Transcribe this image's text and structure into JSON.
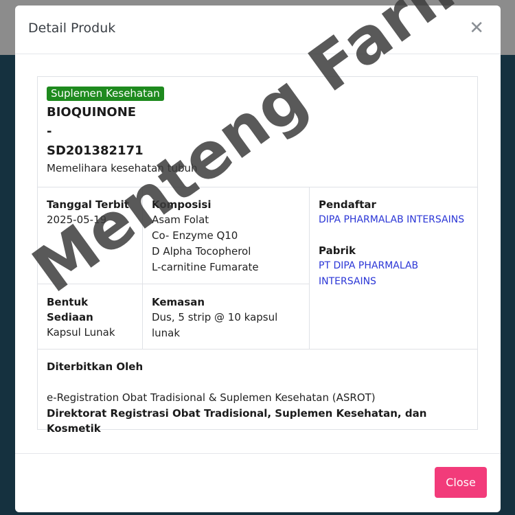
{
  "modal": {
    "title": "Detail Produk",
    "close_icon": "close-icon",
    "close_button": "Close"
  },
  "product": {
    "category_badge": "Suplemen Kesehatan",
    "name_line1": "BIOQUINONE",
    "name_line2": "-",
    "name_line3": "SD201382171",
    "description": "Memelihara kesehatan tubuh"
  },
  "details": {
    "tanggal_label": "Tanggal Terbit",
    "tanggal_value": "2025-05-19",
    "komposisi_label": "Komposisi",
    "komposisi_items": [
      "Asam Folat",
      "Co- Enzyme Q10",
      "D Alpha Tocopherol",
      "L-carnitine Fumarate"
    ],
    "pendaftar_label": "Pendaftar",
    "pendaftar_value": "DIPA PHARMALAB INTERSAINS",
    "pabrik_label": "Pabrik",
    "pabrik_value": "PT DIPA PHARMALAB INTERSAINS",
    "bentuk_label": "Bentuk Sediaan",
    "bentuk_value": "Kapsul Lunak",
    "kemasan_label": "Kemasan",
    "kemasan_value": "Dus, 5 strip @ 10 kapsul lunak",
    "diterbitkan_label": "Diterbitkan Oleh",
    "diterbitkan_value1": "e-Registration Obat Tradisional & Suplemen Kesehatan (ASROT)",
    "diterbitkan_value2": "Direktorat Registrasi Obat Tradisional, Suplemen Kesehatan, dan Kosmetik"
  },
  "watermark": "Menteng Farma",
  "colors": {
    "badge": "#1e8a1e",
    "link": "#2a35d6",
    "close_button": "#f23b7a",
    "backdrop": "#15313f"
  }
}
